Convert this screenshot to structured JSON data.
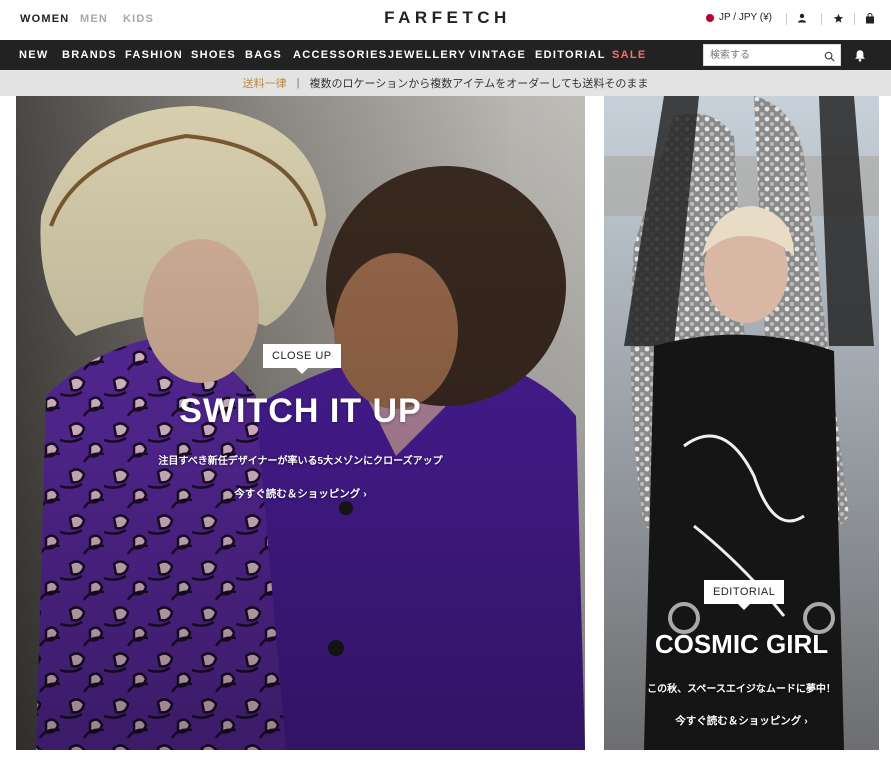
{
  "header": {
    "genders": [
      {
        "label": "WOMEN",
        "active": true
      },
      {
        "label": "MEN",
        "active": false
      },
      {
        "label": "KIDS",
        "active": false
      }
    ],
    "logo": "FARFETCH",
    "region": "JP / JPY (¥)",
    "icons": [
      "account-icon",
      "wishlist-star-icon",
      "bag-icon"
    ]
  },
  "nav": {
    "items": [
      "NEW",
      "BRANDS",
      "FASHION",
      "SHOES",
      "BAGS",
      "ACCESSORIES",
      "JEWELLERY",
      "VINTAGE",
      "EDITORIAL",
      "SALE"
    ],
    "search_placeholder": "検索する"
  },
  "promo": {
    "title": "送料一律",
    "separator": "|",
    "text": "複数のロケーションから複数アイテムをオーダーしても送料そのまま"
  },
  "hero_left": {
    "tag": "CLOSE UP",
    "title": "SWITCH IT UP",
    "subtitle": "注目すべき新任デザイナーが率いる5大メゾンにクローズアップ",
    "cta": "今すぐ読む＆ショッピング ›"
  },
  "hero_right": {
    "tag": "EDITORIAL",
    "title": "COSMIC GIRL",
    "subtitle": "この秋、スペースエイジなムードに夢中！",
    "cta": "今すぐ読む＆ショッピング ›"
  },
  "colors": {
    "nav_bg": "#222222",
    "sale": "#ff6e6e",
    "promo_bg": "#e3e3e3",
    "promo_title": "#b88a4a",
    "jp_flag": "#bc002d"
  }
}
